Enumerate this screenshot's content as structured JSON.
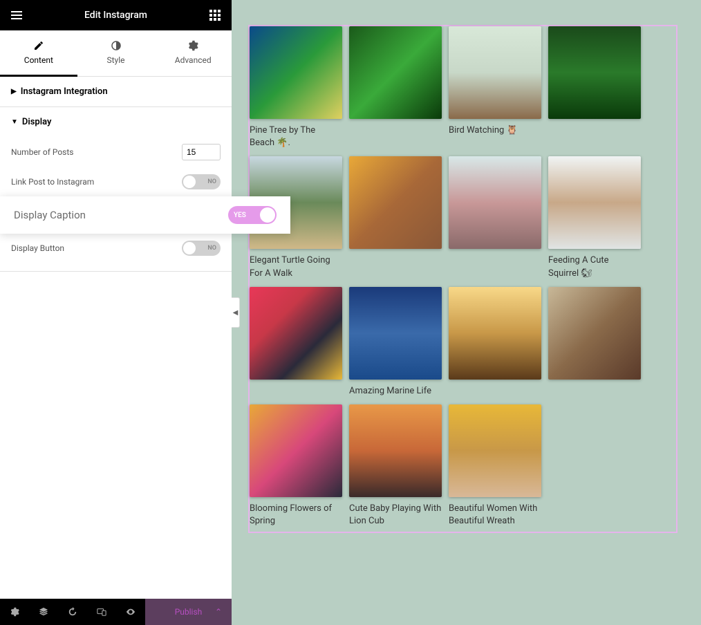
{
  "header": {
    "title": "Edit Instagram"
  },
  "tabs": [
    {
      "label": "Content",
      "active": true
    },
    {
      "label": "Style",
      "active": false
    },
    {
      "label": "Advanced",
      "active": false
    }
  ],
  "sections": {
    "integration": {
      "title": "Instagram Integration"
    },
    "display": {
      "title": "Display",
      "number_of_posts_label": "Number of Posts",
      "number_of_posts_value": "15",
      "link_post_label": "Link Post to Instagram",
      "link_post_value": "NO",
      "display_caption_label": "Display Caption",
      "display_caption_value": "YES",
      "display_button_label": "Display Button",
      "display_button_value": "NO"
    }
  },
  "footer": {
    "publish_label": "Publish"
  },
  "posts": [
    {
      "caption": "Pine Tree by The Beach 🌴.",
      "bg": "linear-gradient(135deg,#0a4a8a,#2a9a3a,#e0d060)"
    },
    {
      "caption": "",
      "bg": "linear-gradient(135deg,#1a5a1a,#3aaa3a,#0a3a0a)"
    },
    {
      "caption": "Bird Watching 🦉",
      "bg": "linear-gradient(180deg,#d8e8d8,#c8d8c8,#8a6a4a)"
    },
    {
      "caption": "",
      "bg": "linear-gradient(180deg,#1a4a1a,#2a7a2a,#0a3a0a)"
    },
    {
      "caption": "Elegant Turtle Going For A Walk",
      "bg": "linear-gradient(180deg,#c8d8e0,#6a8a5a,#d0b888)"
    },
    {
      "caption": "",
      "bg": "linear-gradient(135deg,#e8a838,#a86838,#8a5838)"
    },
    {
      "caption": "",
      "bg": "linear-gradient(180deg,#d8e8e8,#c89898,#8a6a6a)"
    },
    {
      "caption": "Feeding A Cute Squirrel 🐿",
      "bg": "linear-gradient(180deg,#f0f4f4,#c8a888,#e0e4e4)"
    },
    {
      "caption": "",
      "bg": "linear-gradient(135deg,#e83858,#c83848,#2a2a3a,#e8b838)"
    },
    {
      "caption": "Amazing Marine Life",
      "bg": "linear-gradient(180deg,#1a3a7a,#3a6aaa,#1a4a8a)"
    },
    {
      "caption": "",
      "bg": "linear-gradient(180deg,#f8d888,#c89848,#5a3a1a)"
    },
    {
      "caption": "",
      "bg": "linear-gradient(135deg,#c8b898,#8a6a4a,#5a3a2a)"
    },
    {
      "caption": "Blooming Flowers of Spring",
      "bg": "linear-gradient(135deg,#e8a838,#d8487a,#2a2a3a)"
    },
    {
      "caption": "Cute Baby Playing With Lion Cub",
      "bg": "linear-gradient(180deg,#e89848,#c86838,#3a2a2a)"
    },
    {
      "caption": "Beautiful Women With Beautiful Wreath",
      "bg": "linear-gradient(180deg,#e8b838,#c89848,#d8b898)"
    }
  ]
}
